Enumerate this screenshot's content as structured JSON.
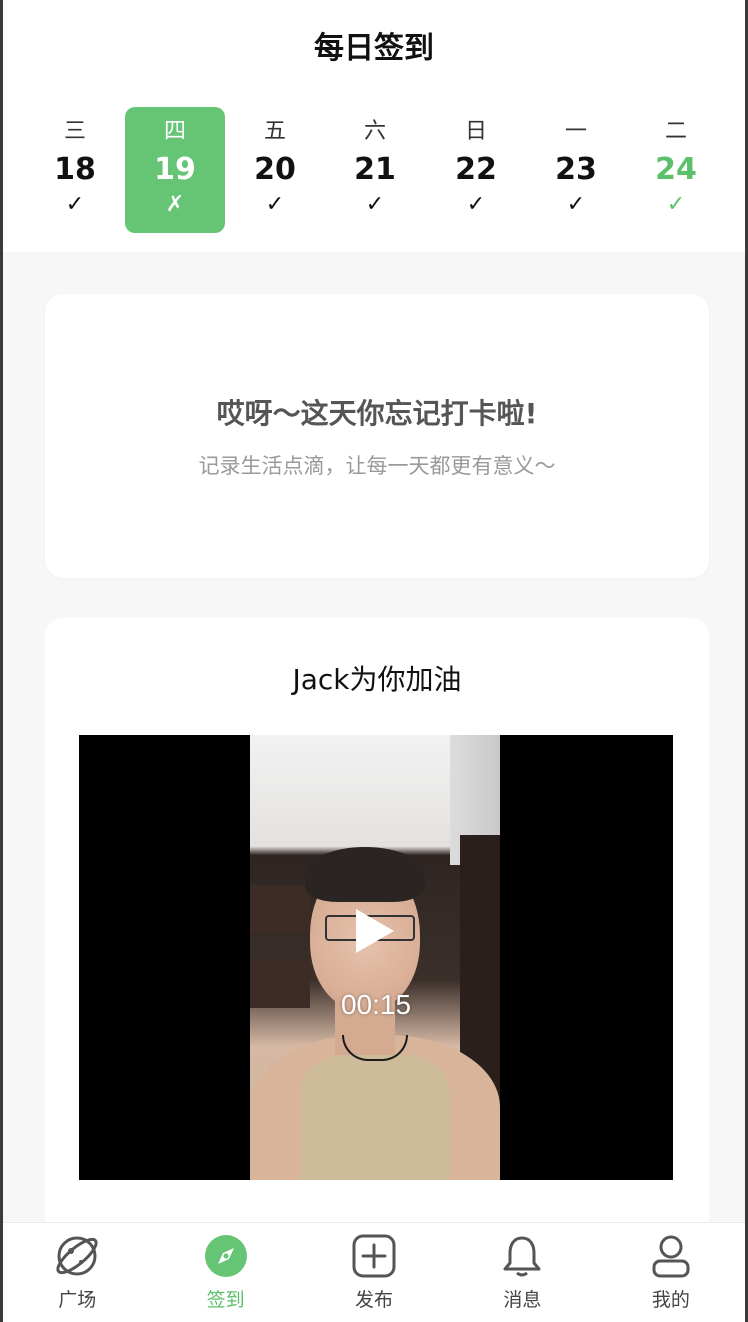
{
  "header": {
    "title": "每日签到"
  },
  "week": [
    {
      "weekday": "三",
      "date": "18",
      "mark": "✓",
      "state": "done"
    },
    {
      "weekday": "四",
      "date": "19",
      "mark": "✗",
      "state": "selected-missed"
    },
    {
      "weekday": "五",
      "date": "20",
      "mark": "✓",
      "state": "done"
    },
    {
      "weekday": "六",
      "date": "21",
      "mark": "✓",
      "state": "done"
    },
    {
      "weekday": "日",
      "date": "22",
      "mark": "✓",
      "state": "done"
    },
    {
      "weekday": "一",
      "date": "23",
      "mark": "✓",
      "state": "done"
    },
    {
      "weekday": "二",
      "date": "24",
      "mark": "✓",
      "state": "today"
    }
  ],
  "missed_card": {
    "title": "哎呀～这天你忘记打卡啦!",
    "subtitle": "记录生活点滴，让每一天都更有意义～"
  },
  "cheer_card": {
    "title": "Jack为你加油",
    "video": {
      "duration": "00:15",
      "icon": "play-icon"
    }
  },
  "tabbar": {
    "items": [
      {
        "label": "广场",
        "icon": "planet-icon",
        "active": false
      },
      {
        "label": "签到",
        "icon": "compass-icon",
        "active": true
      },
      {
        "label": "发布",
        "icon": "plus-square-icon",
        "active": false
      },
      {
        "label": "消息",
        "icon": "bell-icon",
        "active": false
      },
      {
        "label": "我的",
        "icon": "user-icon",
        "active": false
      }
    ]
  },
  "colors": {
    "accent": "#66c574",
    "text": "#111111",
    "muted": "#9a9a9a",
    "background": "#f7f7f7"
  }
}
